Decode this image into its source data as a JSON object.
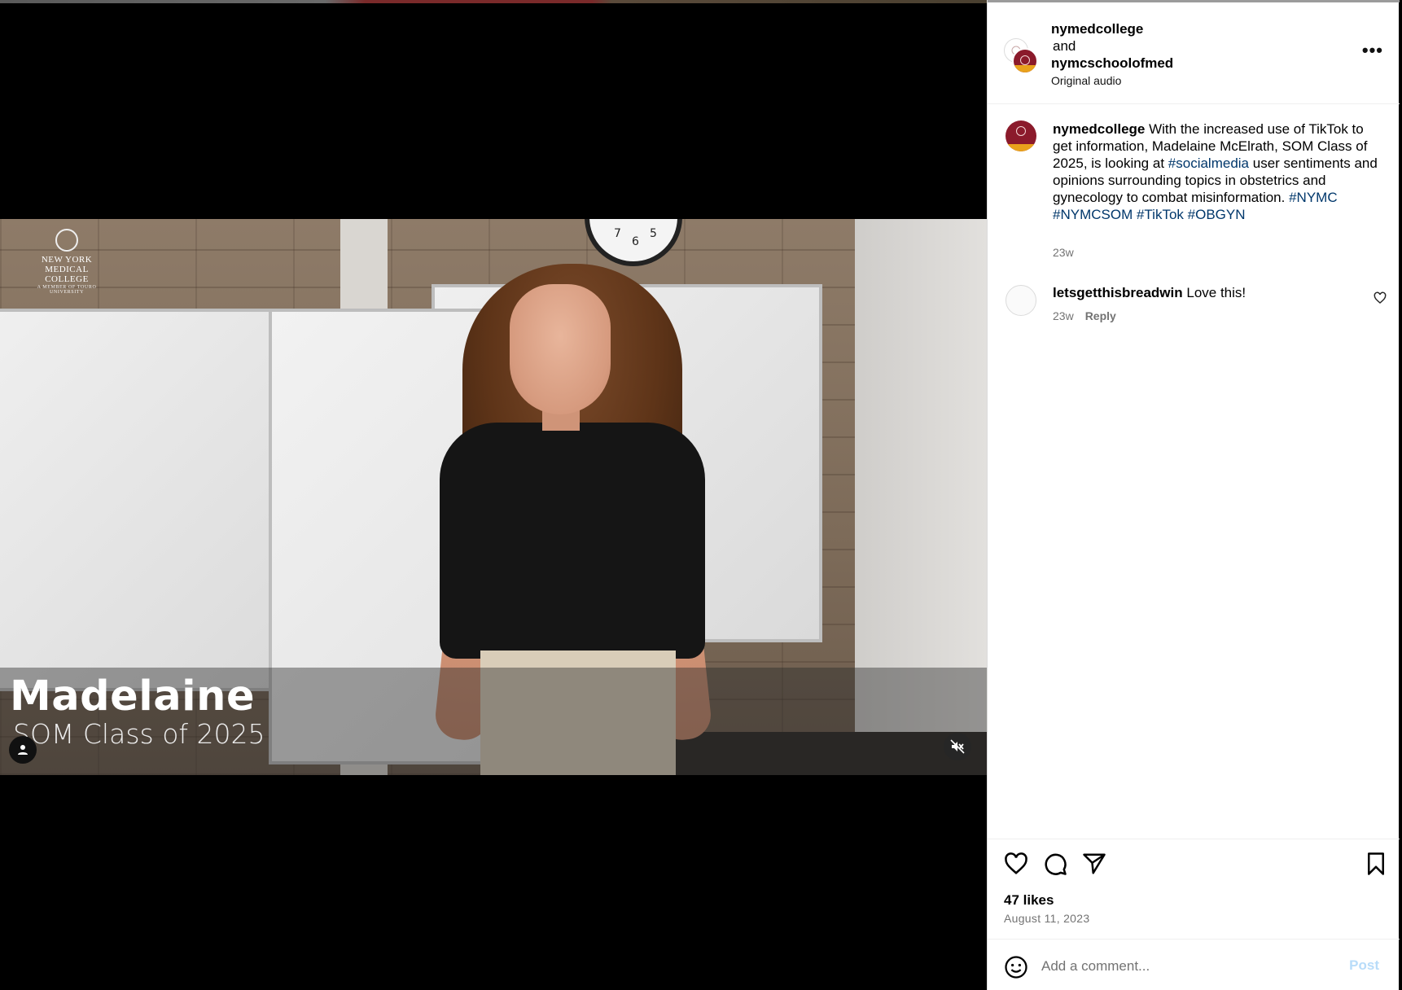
{
  "video": {
    "logo_line1": "NEW YORK",
    "logo_line2": "MEDICAL COLLEGE",
    "logo_line3": "A MEMBER OF TOURO UNIVERSITY",
    "lower_third_name": "Madelaine",
    "lower_third_subtitle": "SOM Class of 2025",
    "muted": true
  },
  "header": {
    "user1": "nymedcollege",
    "joiner": "and",
    "user2": "nymcschoolofmed",
    "audio": "Original audio"
  },
  "caption": {
    "username": "nymedcollege",
    "text_1": "With the increased use of TikTok to get information, Madelaine McElrath, SOM Class of 2025, is looking at",
    "tag_1": "#socialmedia",
    "text_2": "user sentiments and opinions surrounding topics in obstetrics and gynecology to combat misinformation.",
    "tags": [
      "#NYMC",
      "#NYMCSOM",
      "#TikTok",
      "#OBGYN"
    ],
    "time": "23w"
  },
  "comments": [
    {
      "username": "letsgetthisbreadwin",
      "text": "Love this!",
      "time": "23w",
      "reply_label": "Reply"
    }
  ],
  "footer": {
    "likes": "47 likes",
    "date": "August 11, 2023",
    "comment_placeholder": "Add a comment...",
    "post_label": "Post"
  },
  "colors": {
    "brand_maroon": "#8b1a2b",
    "brand_gold": "#e9a21c",
    "hashtag": "#00376b",
    "post_disabled": "#b8dcf9"
  }
}
